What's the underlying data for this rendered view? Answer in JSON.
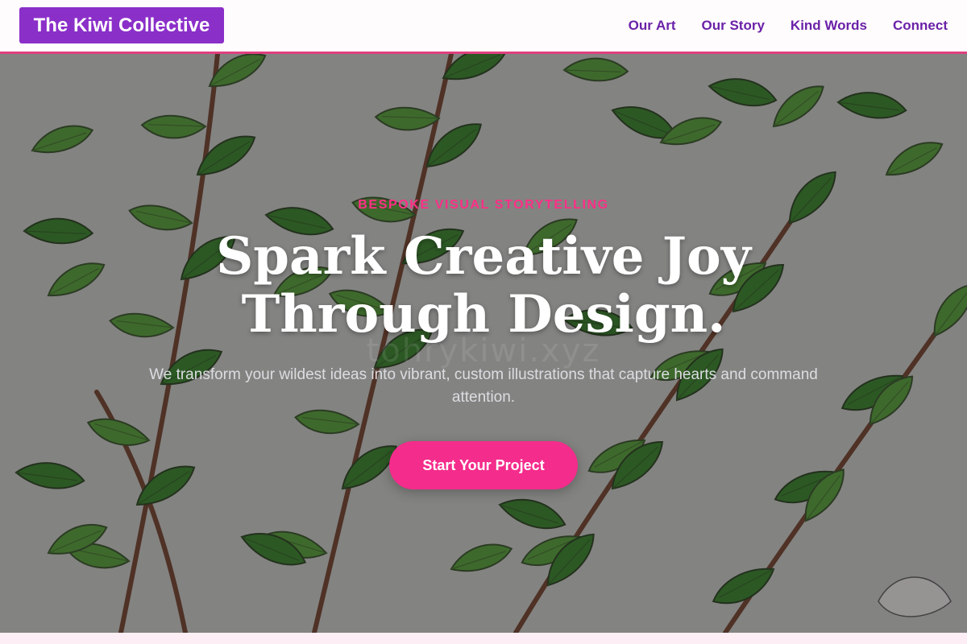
{
  "header": {
    "logo": "The Kiwi Collective",
    "nav": [
      "Our Art",
      "Our Story",
      "Kind Words",
      "Connect"
    ]
  },
  "hero": {
    "eyebrow": "BESPOKE VISUAL STORYTELLING",
    "headline_line1": "Spark Creative Joy",
    "headline_line2": "Through Design.",
    "subtitle": "We transform your wildest ideas into vibrant, custom illustrations that capture hearts and command attention.",
    "cta_label": "Start Your Project",
    "watermark": "tohrykiwi.xyz"
  },
  "colors": {
    "brand_purple": "#8b2fc9",
    "nav_purple": "#6a21a8",
    "accent_pink": "#f42c8c",
    "header_border": "#e0407f"
  }
}
